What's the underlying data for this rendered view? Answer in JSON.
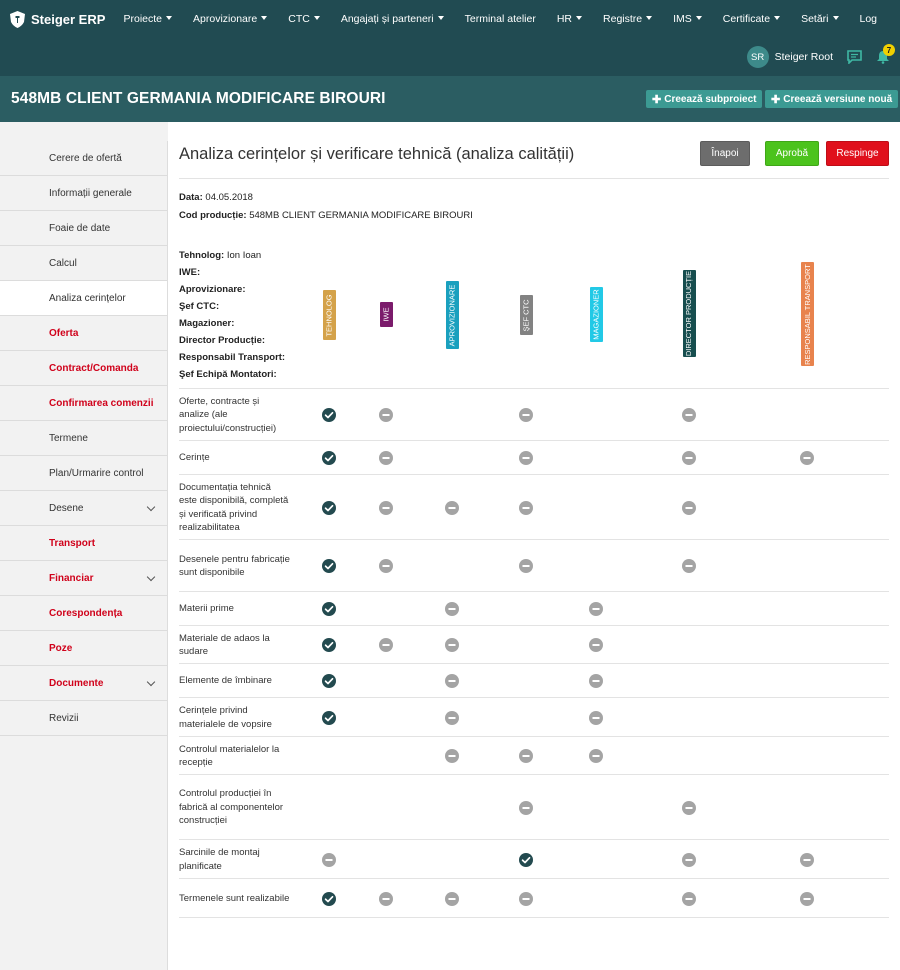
{
  "app": {
    "brand": "Steiger ERP",
    "menu": [
      {
        "label": "Proiecte",
        "dropdown": true
      },
      {
        "label": "Aprovizionare",
        "dropdown": true
      },
      {
        "label": "CTC",
        "dropdown": true
      },
      {
        "label": "Angajați și parteneri",
        "dropdown": true
      },
      {
        "label": "Terminal atelier",
        "dropdown": false
      },
      {
        "label": "HR",
        "dropdown": true
      },
      {
        "label": "Registre",
        "dropdown": true
      },
      {
        "label": "IMS",
        "dropdown": true
      },
      {
        "label": "Certificate",
        "dropdown": true
      },
      {
        "label": "Setări",
        "dropdown": true
      },
      {
        "label": "Log",
        "dropdown": false
      }
    ],
    "user": {
      "initials": "SR",
      "name": "Steiger Root",
      "notifications": "7"
    }
  },
  "project": {
    "title": "548MB CLIENT GERMANIA MODIFICARE BIROURI",
    "btn_subproject": "Creează subproiect",
    "btn_version": "Creează versiune nouă"
  },
  "sidebar": [
    {
      "label": "Cerere de ofertă",
      "red": false,
      "active": false,
      "chevron": false
    },
    {
      "label": "Informații generale",
      "red": false,
      "active": false,
      "chevron": false
    },
    {
      "label": "Foaie de date",
      "red": false,
      "active": false,
      "chevron": false
    },
    {
      "label": "Calcul",
      "red": false,
      "active": false,
      "chevron": false
    },
    {
      "label": "Analiza cerințelor",
      "red": false,
      "active": true,
      "chevron": false
    },
    {
      "label": "Oferta",
      "red": true,
      "active": false,
      "chevron": false
    },
    {
      "label": "Contract/Comanda",
      "red": true,
      "active": false,
      "chevron": false
    },
    {
      "label": "Confirmarea comenzii",
      "red": true,
      "active": false,
      "chevron": false
    },
    {
      "label": "Termene",
      "red": false,
      "active": false,
      "chevron": false
    },
    {
      "label": "Plan/Urmarire control",
      "red": false,
      "active": false,
      "chevron": false
    },
    {
      "label": "Desene",
      "red": false,
      "active": false,
      "chevron": true
    },
    {
      "label": "Transport",
      "red": true,
      "active": false,
      "chevron": false
    },
    {
      "label": "Financiar",
      "red": true,
      "active": false,
      "chevron": true
    },
    {
      "label": "Corespondența",
      "red": true,
      "active": false,
      "chevron": false
    },
    {
      "label": "Poze",
      "red": true,
      "active": false,
      "chevron": false
    },
    {
      "label": "Documente",
      "red": true,
      "active": false,
      "chevron": true
    },
    {
      "label": "Revizii",
      "red": false,
      "active": false,
      "chevron": false
    }
  ],
  "page": {
    "title": "Analiza cerințelor și verificare tehnică (analiza calității)",
    "btn_back": "Înapoi",
    "btn_approve": "Aprobă",
    "btn_reject": "Respinge",
    "date_label": "Data:",
    "date_value": "04.05.2018",
    "code_label": "Cod producție:",
    "code_value": "548MB CLIENT GERMANIA MODIFICARE BIROURI"
  },
  "colors": {
    "back": "#6d6d6d",
    "approve": "#4cc31d",
    "reject": "#e0101c",
    "check": "#234a4f",
    "minus": "#a4a4a4"
  },
  "roles": [
    {
      "label": "Tehnolog:",
      "value": "Ion Ioan"
    },
    {
      "label": "IWE:",
      "value": ""
    },
    {
      "label": "Aprovizionare:",
      "value": ""
    },
    {
      "label": "Şef CTC:",
      "value": ""
    },
    {
      "label": "Magazioner:",
      "value": ""
    },
    {
      "label": "Director Producție:",
      "value": ""
    },
    {
      "label": "Responsabil Transport:",
      "value": ""
    },
    {
      "label": "Şef Echipă Montatori:",
      "value": ""
    }
  ],
  "columns": [
    {
      "label": "TEHNOLOG",
      "color": "#d4a24a"
    },
    {
      "label": "IWE",
      "color": "#7b1b6b"
    },
    {
      "label": "APROVIZIONARE",
      "color": "#1aa0be"
    },
    {
      "label": "ŞEF CTC",
      "color": "#828282"
    },
    {
      "label": "MAGAZIONER",
      "color": "#22c9e6"
    },
    {
      "label": "DIRECTOR PRODUCȚIE",
      "color": "#174e4f"
    },
    {
      "label": "RESPONSABIL TRANSPORT",
      "color": "#e8834d"
    }
  ],
  "rows": [
    {
      "label": "Oferte, contracte și analize (ale proiectului/construcției)",
      "cells": [
        "check",
        "minus",
        "",
        "minus",
        "",
        "minus",
        ""
      ]
    },
    {
      "label": "Cerințe",
      "cells": [
        "check",
        "minus",
        "",
        "minus",
        "",
        "minus",
        "minus"
      ]
    },
    {
      "label": "Documentația tehnică este disponibilă, completă și verificată privind realizabilitatea",
      "cells": [
        "check",
        "minus",
        "minus",
        "minus",
        "",
        "minus",
        ""
      ]
    },
    {
      "label": "Desenele pentru fabricație sunt disponibile",
      "cells": [
        "check",
        "minus",
        "",
        "minus",
        "",
        "minus",
        ""
      ]
    },
    {
      "label": "Materii prime",
      "cells": [
        "check",
        "",
        "minus",
        "",
        "minus",
        "",
        ""
      ]
    },
    {
      "label": "Materiale de adaos la sudare",
      "cells": [
        "check",
        "minus",
        "minus",
        "",
        "minus",
        "",
        ""
      ]
    },
    {
      "label": "Elemente de îmbinare",
      "cells": [
        "check",
        "",
        "minus",
        "",
        "minus",
        "",
        ""
      ]
    },
    {
      "label": "Cerințele privind materialele de vopsire",
      "cells": [
        "check",
        "",
        "minus",
        "",
        "minus",
        "",
        ""
      ]
    },
    {
      "label": "Controlul materialelor la recepție",
      "cells": [
        "",
        "",
        "minus",
        "minus",
        "minus",
        "",
        ""
      ]
    },
    {
      "label": "Controlul producției în fabrică al componentelor construcției",
      "cells": [
        "",
        "",
        "",
        "minus",
        "",
        "minus",
        ""
      ]
    },
    {
      "label": "Sarcinile de montaj planificate",
      "cells": [
        "minus",
        "",
        "",
        "check",
        "",
        "minus",
        "minus"
      ]
    },
    {
      "label": "Termenele sunt realizabile",
      "cells": [
        "check",
        "minus",
        "minus",
        "minus",
        "",
        "minus",
        "minus"
      ]
    }
  ]
}
